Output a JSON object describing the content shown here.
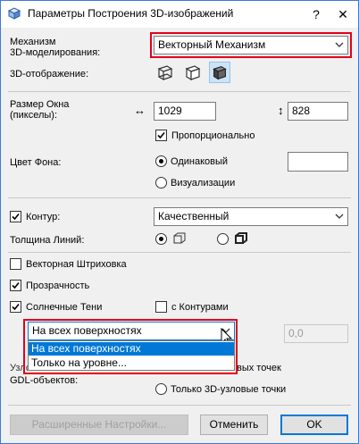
{
  "window": {
    "title": "Параметры Построения 3D-изображений",
    "help_label": "?",
    "close_label": "✕"
  },
  "engine": {
    "label_line1": "Механизм",
    "label_line2": "3D-моделирования:",
    "value": "Векторный Механизм"
  },
  "display": {
    "label": "3D-отображение:",
    "modes": [
      "wireframe",
      "hidden-line",
      "shading"
    ],
    "selected_mode": "shading"
  },
  "window_size": {
    "label_line1": "Размер Окна",
    "label_line2": "(пикселы):",
    "width": "1029",
    "height": "828",
    "proportional_label": "Пропорционально",
    "proportional_checked": true
  },
  "background": {
    "label": "Цвет Фона:",
    "option_same": "Одинаковый",
    "option_render": "Визуализации",
    "selected": "same",
    "swatch_color": "#ffffff"
  },
  "contour": {
    "label": "Контур:",
    "checked": true,
    "value": "Качественный"
  },
  "line_weight": {
    "label": "Толщина Линий:",
    "selected": "thin"
  },
  "vector_hatching": {
    "label": "Векторная Штриховка",
    "checked": false
  },
  "transparency": {
    "label": "Прозрачность",
    "checked": true
  },
  "sun_shadows": {
    "label": "Солнечные Тени",
    "checked": true,
    "with_contours_label": "с Контурами",
    "with_contours_checked": false,
    "surface_value": "На всех поверхностях",
    "options": [
      "На всех поверхностях",
      "Только на уровне..."
    ],
    "highlighted_option": "На всех поверхностях",
    "level_value": "0,0"
  },
  "hotspots": {
    "label_line1": "Узловые точки",
    "label_line2": "GDL-объектов:",
    "option_all_suffix": "вых точек",
    "option_3d_only": "Только 3D-узловые точки",
    "selected": "all"
  },
  "buttons": {
    "advanced": "Расширенные Настройки...",
    "cancel": "Отменить",
    "ok": "OK"
  },
  "colors": {
    "highlight_frame": "#e4001b",
    "selection_blue": "#0078d7",
    "selected_mode_bg": "#cce4f7"
  }
}
